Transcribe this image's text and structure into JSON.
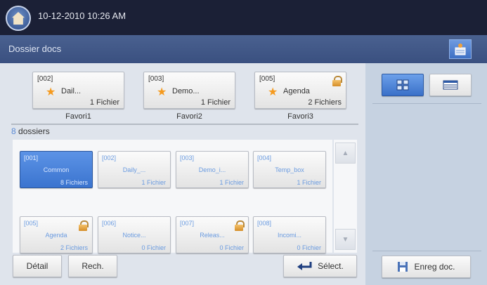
{
  "header": {
    "datetime": "10-12-2010 10:26 AM"
  },
  "title": "Dossier docs",
  "favorites": [
    {
      "id": "[002]",
      "name": "Dail...",
      "count": "1 Fichier",
      "label": "Favori1",
      "locked": false
    },
    {
      "id": "[003]",
      "name": "Demo...",
      "count": "1 Fichier",
      "label": "Favori2",
      "locked": false
    },
    {
      "id": "[005]",
      "name": "Agenda",
      "count": "2 Fichiers",
      "label": "Favori3",
      "locked": true
    }
  ],
  "folder_count": {
    "number": "8",
    "label": " dossiers"
  },
  "folders": [
    {
      "id": "[001]",
      "name": "Common",
      "count": "8 Fichiers",
      "selected": true
    },
    {
      "id": "[002]",
      "name": "Daily_...",
      "count": "1 Fichier"
    },
    {
      "id": "[003]",
      "name": "Demo_i...",
      "count": "1 Fichier"
    },
    {
      "id": "[004]",
      "name": "Temp_box",
      "count": "1 Fichier"
    },
    {
      "id": "[005]",
      "name": "Agenda",
      "count": "2 Fichiers",
      "locked": true
    },
    {
      "id": "[006]",
      "name": "Notice...",
      "count": "0 Fichier"
    },
    {
      "id": "[007]",
      "name": "Releas...",
      "count": "0 Fichier",
      "locked": true
    },
    {
      "id": "[008]",
      "name": "Incomi...",
      "count": "0 Fichier"
    }
  ],
  "buttons": {
    "detail": "Détail",
    "search": "Rech.",
    "select": "Sélect.",
    "save": "Enreg doc."
  },
  "colors": {
    "accent": "#3b74cf",
    "topbar": "#1b2036",
    "titlebar": "#3a5080"
  }
}
